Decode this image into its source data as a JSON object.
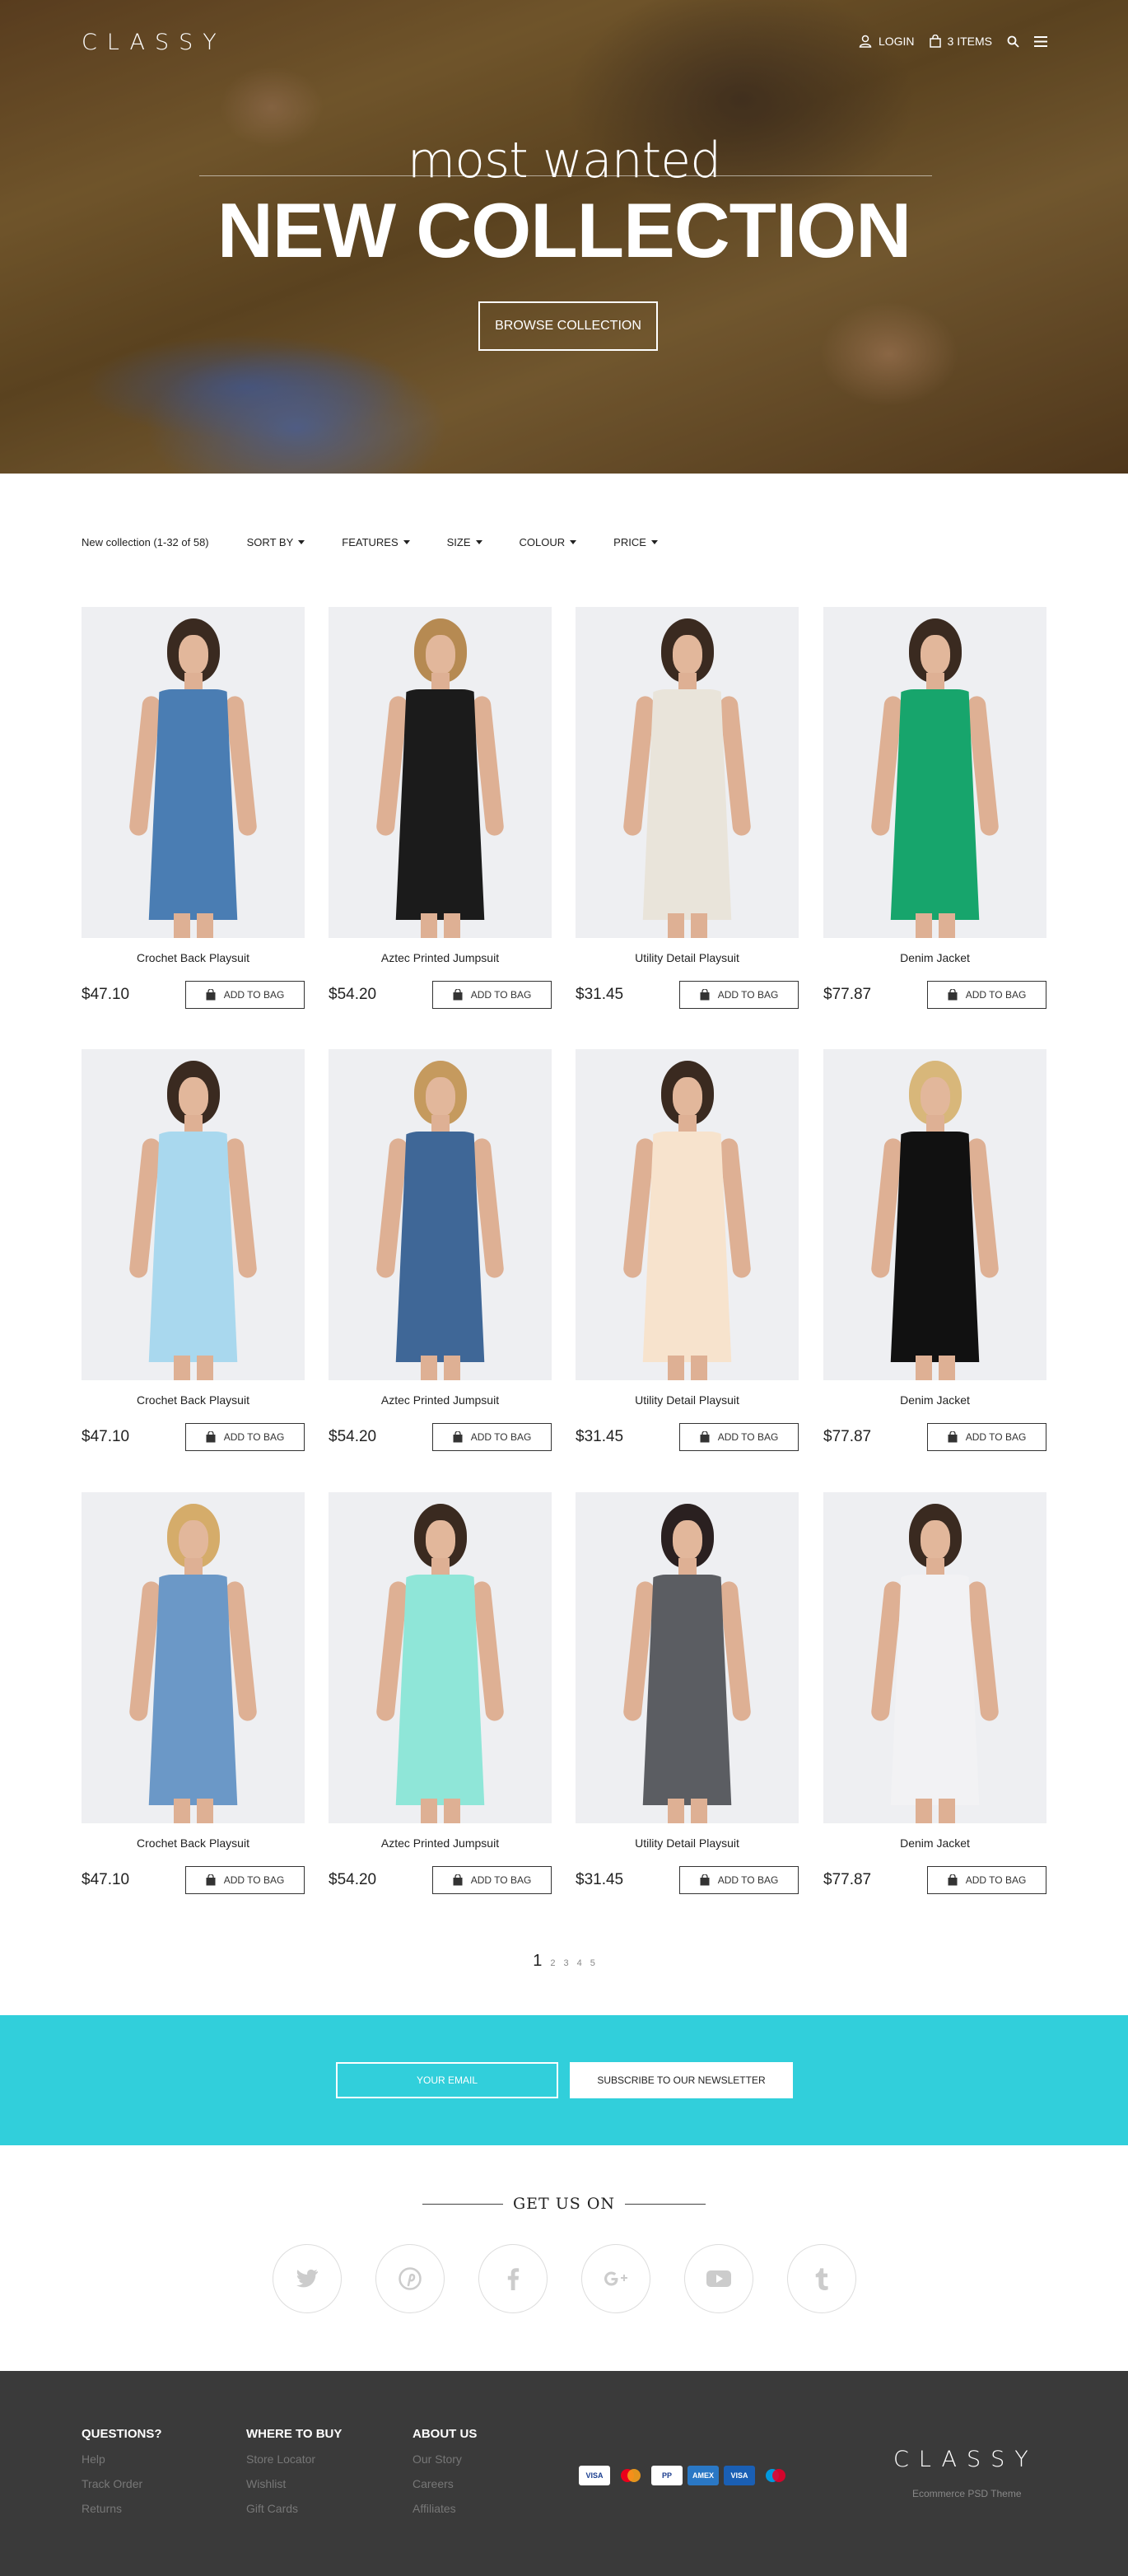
{
  "brand": {
    "logo": "CLASSY",
    "footer_tagline": "Ecommerce PSD Theme"
  },
  "nav": {
    "login_label": "LOGIN",
    "bag_label": "3 ITEMS"
  },
  "hero": {
    "subtitle": "most wanted",
    "title": "NEW COLLECTION",
    "cta_label": "BROWSE COLLECTION"
  },
  "filters": {
    "count_text": "New collection (1-32 of 58)",
    "items": [
      "SORT BY",
      "FEATURES",
      "SIZE",
      "COLOUR",
      "PRICE"
    ]
  },
  "add_to_bag_label": "ADD TO BAG",
  "products": [
    {
      "name": "Crochet Back Playsuit",
      "price": "$47.10",
      "dress_color": "#4a7db3",
      "hair_color": "#3a2a20"
    },
    {
      "name": "Aztec Printed Jumpsuit",
      "price": "$54.20",
      "dress_color": "#1b1b1b",
      "hair_color": "#b68a52"
    },
    {
      "name": "Utility Detail Playsuit",
      "price": "$31.45",
      "dress_color": "#e9e4da",
      "hair_color": "#3a2a20"
    },
    {
      "name": "Denim Jacket",
      "price": "$77.87",
      "dress_color": "#17a56c",
      "hair_color": "#3a2a20"
    },
    {
      "name": "Crochet Back Playsuit",
      "price": "$47.10",
      "dress_color": "#a9d8ee",
      "hair_color": "#3a2a20"
    },
    {
      "name": "Aztec Printed Jumpsuit",
      "price": "$54.20",
      "dress_color": "#3f6797",
      "hair_color": "#c59a5e"
    },
    {
      "name": "Utility Detail Playsuit",
      "price": "$31.45",
      "dress_color": "#f7e3cd",
      "hair_color": "#3a2a20"
    },
    {
      "name": "Denim Jacket",
      "price": "$77.87",
      "dress_color": "#111111",
      "hair_color": "#d8b77a"
    },
    {
      "name": "Crochet Back Playsuit",
      "price": "$47.10",
      "dress_color": "#6b98c7",
      "hair_color": "#d5ac6a"
    },
    {
      "name": "Aztec Printed Jumpsuit",
      "price": "$54.20",
      "dress_color": "#8fe6d8",
      "hair_color": "#3a2a20"
    },
    {
      "name": "Utility Detail Playsuit",
      "price": "$31.45",
      "dress_color": "#5b5d62",
      "hair_color": "#2a2020"
    },
    {
      "name": "Denim Jacket",
      "price": "$77.87",
      "dress_color": "#f2f2f4",
      "hair_color": "#3a2a20"
    }
  ],
  "pagination": {
    "pages": [
      "1",
      "2",
      "3",
      "4",
      "5"
    ],
    "current": "1"
  },
  "newsletter": {
    "email_placeholder": "YOUR EMAIL",
    "subscribe_label": "SUBSCRIBE TO OUR NEWSLETTER"
  },
  "social": {
    "heading": "GET US ON",
    "networks": [
      "twitter-icon",
      "pinterest-icon",
      "facebook-icon",
      "google-plus-icon",
      "youtube-icon",
      "tumblr-icon"
    ]
  },
  "footer": {
    "columns": [
      {
        "title": "QUESTIONS?",
        "links": [
          "Help",
          "Track Order",
          "Returns"
        ]
      },
      {
        "title": "WHERE TO BUY",
        "links": [
          "Store Locator",
          "Wishlist",
          "Gift Cards"
        ]
      },
      {
        "title": "ABOUT US",
        "links": [
          "Our Story",
          "Careers",
          "Affiliates"
        ]
      }
    ],
    "payment_cards": [
      "VISA",
      "MC",
      "PP",
      "AMEX",
      "VISA",
      "Maestro"
    ]
  },
  "colors": {
    "accent": "#31cfdb",
    "footer_bg": "#3a3a3a"
  }
}
